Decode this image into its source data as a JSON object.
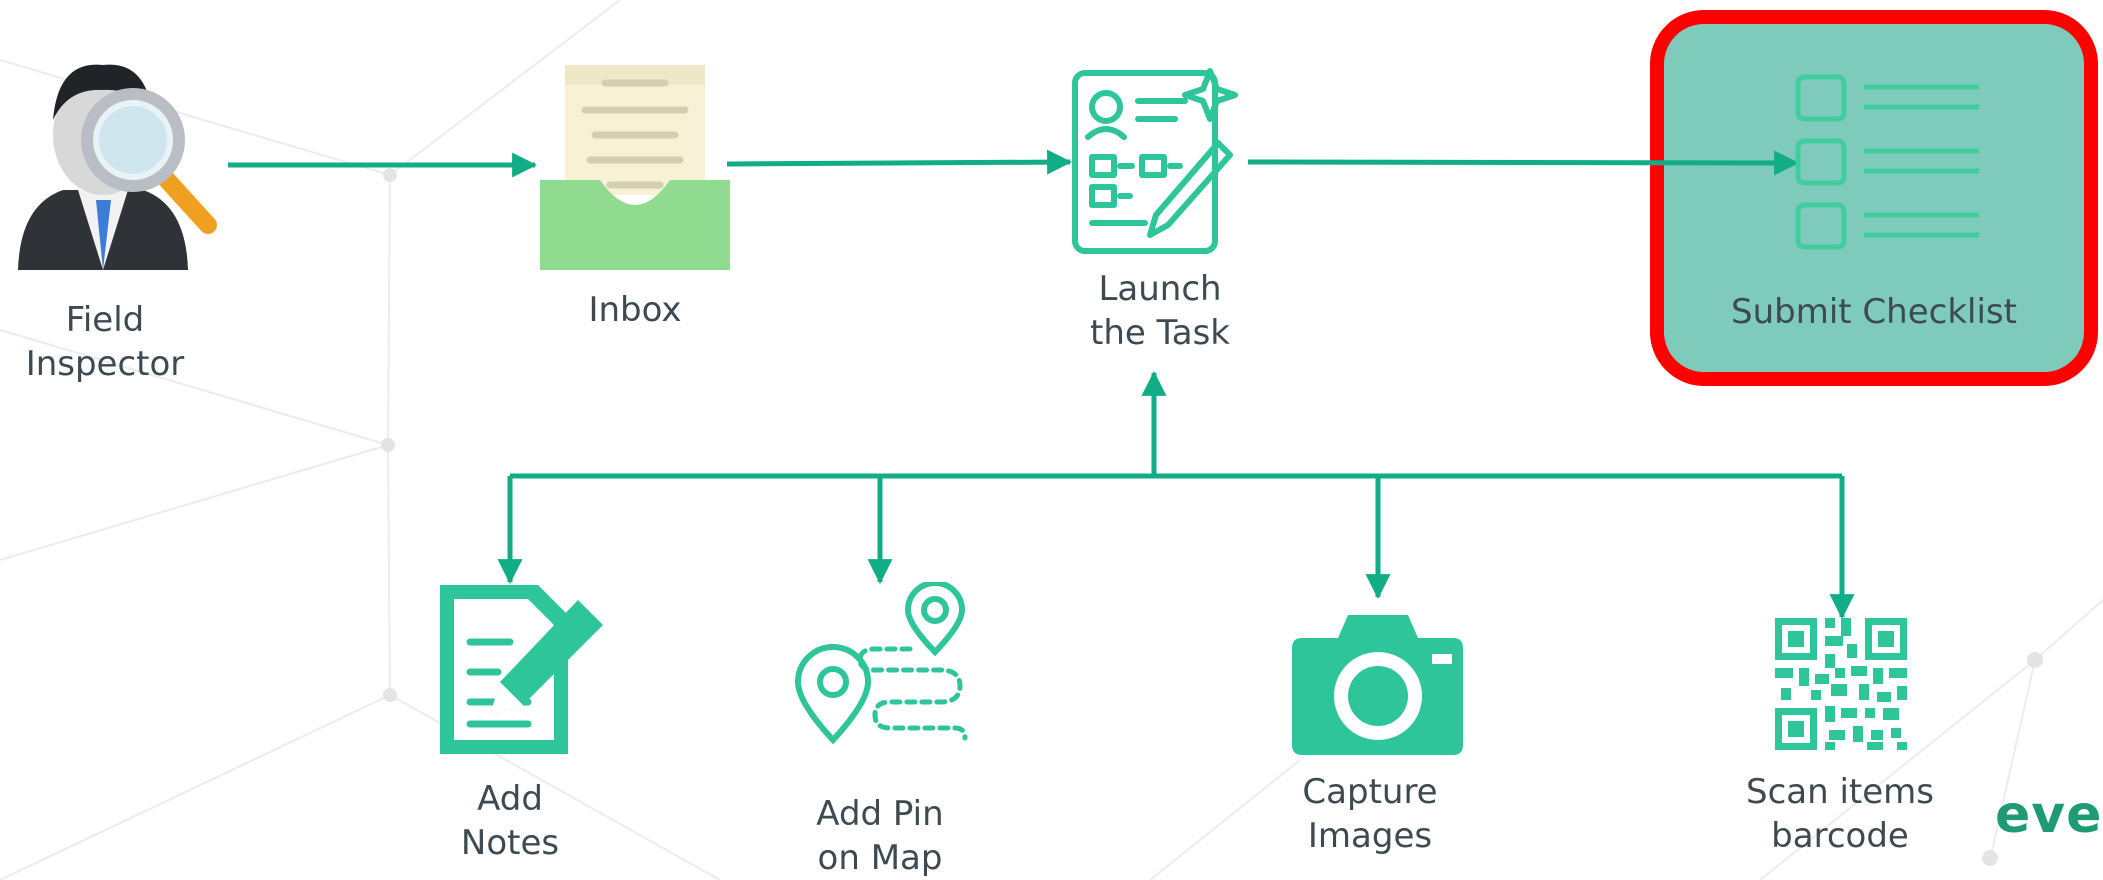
{
  "colors": {
    "accent": "#2fc59a",
    "connector": "#11ad86",
    "highlight_border": "#ff0000",
    "highlight_fill": "#7fcbbb",
    "brand": "#1e9b73"
  },
  "nodes": {
    "field_inspector": {
      "label": "Field\nInspector",
      "icon": "inspector-magnifier-icon"
    },
    "inbox": {
      "label": "Inbox",
      "icon": "inbox-tray-icon"
    },
    "launch_task": {
      "label": "Launch\nthe Task",
      "icon": "task-form-pencil-icon"
    },
    "submit_checklist": {
      "label": "Submit Checklist",
      "icon": "checklist-icon"
    },
    "add_notes": {
      "label": "Add\nNotes",
      "icon": "notes-pencil-icon"
    },
    "add_pin": {
      "label": "Add Pin\non Map",
      "icon": "map-pins-route-icon"
    },
    "capture_images": {
      "label": "Capture\nImages",
      "icon": "camera-icon"
    },
    "scan_barcode": {
      "label": "Scan items\nbarcode",
      "icon": "qr-code-icon"
    }
  },
  "brand": {
    "text": "ever"
  }
}
